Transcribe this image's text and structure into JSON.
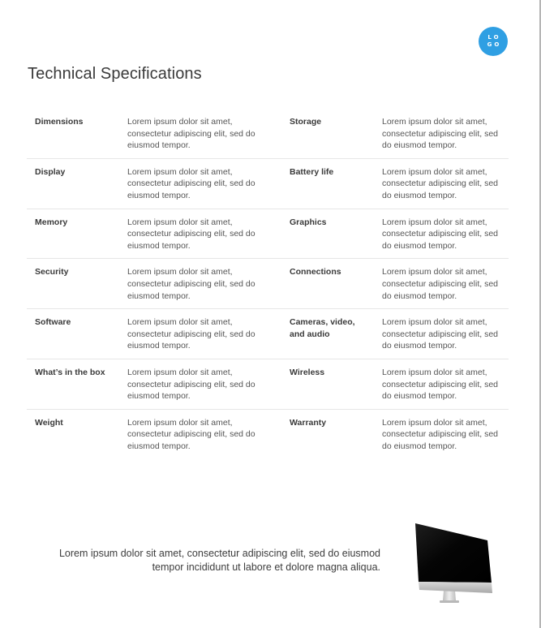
{
  "logo": {
    "line1": "LO",
    "line2": "GO",
    "color": "#2f9fe3"
  },
  "page": {
    "title": "Technical Specifications"
  },
  "specs": {
    "rows": [
      {
        "left": {
          "label": "Dimensions",
          "value": "Lorem ipsum dolor sit amet, consectetur adipiscing elit, sed do eiusmod tempor."
        },
        "right": {
          "label": "Storage",
          "value": "Lorem ipsum dolor sit amet, consectetur adipiscing elit, sed do eiusmod tempor."
        }
      },
      {
        "left": {
          "label": "Display",
          "value": "Lorem ipsum dolor sit amet, consectetur adipiscing elit, sed do eiusmod tempor."
        },
        "right": {
          "label": "Battery life",
          "value": "Lorem ipsum dolor sit amet, consectetur adipiscing elit, sed do eiusmod tempor."
        }
      },
      {
        "left": {
          "label": "Memory",
          "value": "Lorem ipsum dolor sit amet, consectetur adipiscing elit, sed do eiusmod tempor."
        },
        "right": {
          "label": "Graphics",
          "value": "Lorem ipsum dolor sit amet, consectetur adipiscing elit, sed do eiusmod tempor."
        }
      },
      {
        "left": {
          "label": "Security",
          "value": "Lorem ipsum dolor sit amet, consectetur adipiscing elit, sed do eiusmod tempor."
        },
        "right": {
          "label": "Connections",
          "value": "Lorem ipsum dolor sit amet, consectetur adipiscing elit, sed do eiusmod tempor."
        }
      },
      {
        "left": {
          "label": "Software",
          "value": "Lorem ipsum dolor sit amet, consectetur adipiscing elit, sed do eiusmod tempor."
        },
        "right": {
          "label": "Cameras, video, and audio",
          "value": "Lorem ipsum dolor sit amet, consectetur adipiscing elit, sed do eiusmod tempor."
        }
      },
      {
        "left": {
          "label": "What’s in the box",
          "value": "Lorem ipsum dolor sit amet, consectetur adipiscing elit, sed do eiusmod tempor."
        },
        "right": {
          "label": "Wireless",
          "value": "Lorem ipsum dolor sit amet, consectetur adipiscing elit, sed do eiusmod tempor."
        }
      },
      {
        "left": {
          "label": "Weight",
          "value": "Lorem ipsum dolor sit amet, consectetur adipiscing elit, sed do eiusmod tempor."
        },
        "right": {
          "label": "Warranty",
          "value": "Lorem ipsum dolor sit amet, consectetur adipiscing elit, sed do eiusmod tempor."
        }
      }
    ]
  },
  "footer": {
    "text": "Lorem ipsum dolor sit amet, consectetur adipiscing elit, sed do eiusmod tempor incididunt ut labore et dolore magna aliqua.",
    "image_icon": "desktop-monitor-icon"
  }
}
